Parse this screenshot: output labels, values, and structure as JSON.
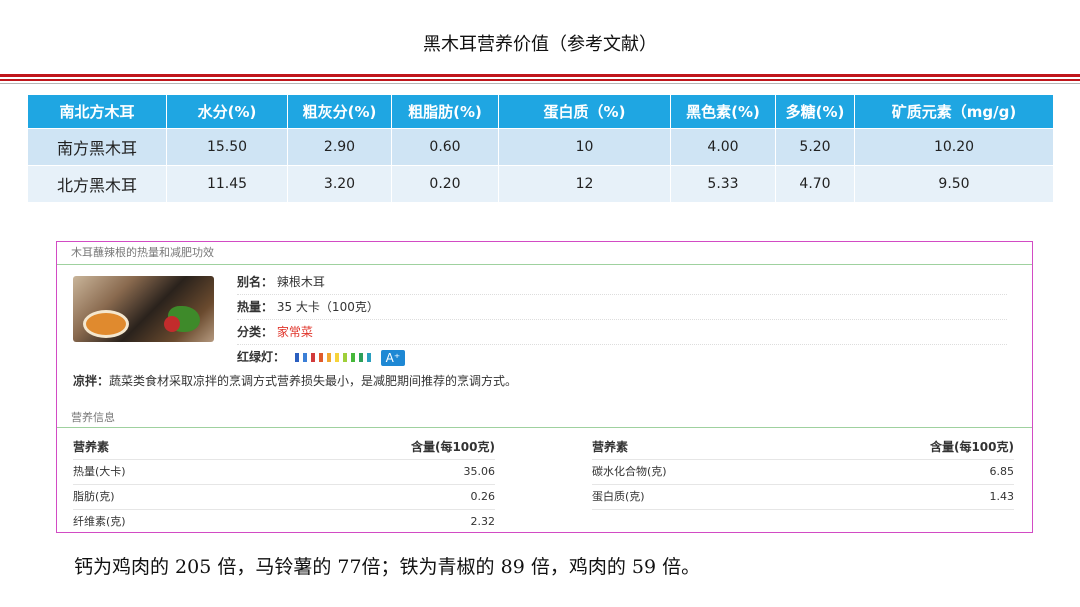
{
  "title": "黑木耳营养价值（参考文献）",
  "table": {
    "headers": [
      "南北方木耳",
      "水分(%)",
      "粗灰分(%)",
      "粗脂肪(%)",
      "蛋白质（%)",
      "黑色素(%)",
      "多糖(%)",
      "矿质元素（mg/g)"
    ],
    "rows": [
      [
        "南方黑木耳",
        "15.50",
        "2.90",
        "0.60",
        "10",
        "4.00",
        "5.20",
        "10.20"
      ],
      [
        "北方黑木耳",
        "11.45",
        "3.20",
        "0.20",
        "12",
        "5.33",
        "4.70",
        "9.50"
      ]
    ]
  },
  "panel": {
    "title": "木耳蘸辣根的热量和减肥功效",
    "alias_label": "别名：",
    "alias_value": "辣根木耳",
    "calorie_label": "热量：",
    "calorie_value": "35 大卡（100克）",
    "category_label": "分类：",
    "category_value": "家常菜",
    "light_label": "红绿灯：",
    "grade": "A⁺",
    "desc_label": "凉拌：",
    "desc_text": "蔬菜类食材采取凉拌的烹调方式营养损失最小，是减肥期间推荐的烹调方式。",
    "section_title": "营养信息",
    "nutrient_header": "营养素",
    "amount_header": "含量(每100克)",
    "left_rows": [
      {
        "name": "热量(大卡)",
        "value": "35.06"
      },
      {
        "name": "脂肪(克)",
        "value": "0.26"
      },
      {
        "name": "纤维素(克)",
        "value": "2.32"
      }
    ],
    "right_rows": [
      {
        "name": "碳水化合物(克)",
        "value": "6.85"
      },
      {
        "name": "蛋白质(克)",
        "value": "1.43"
      }
    ],
    "light_colors": [
      "#2b5fbf",
      "#3b7fd6",
      "#d23b3b",
      "#e05a2a",
      "#f0a830",
      "#f6d33a",
      "#9fcf3a",
      "#46b83a",
      "#2e9f5a",
      "#2b9fbf"
    ]
  },
  "footer_text": "钙为鸡肉的 205 倍，马铃薯的 77倍；铁为青椒的 89 倍，鸡肉的 59 倍。"
}
